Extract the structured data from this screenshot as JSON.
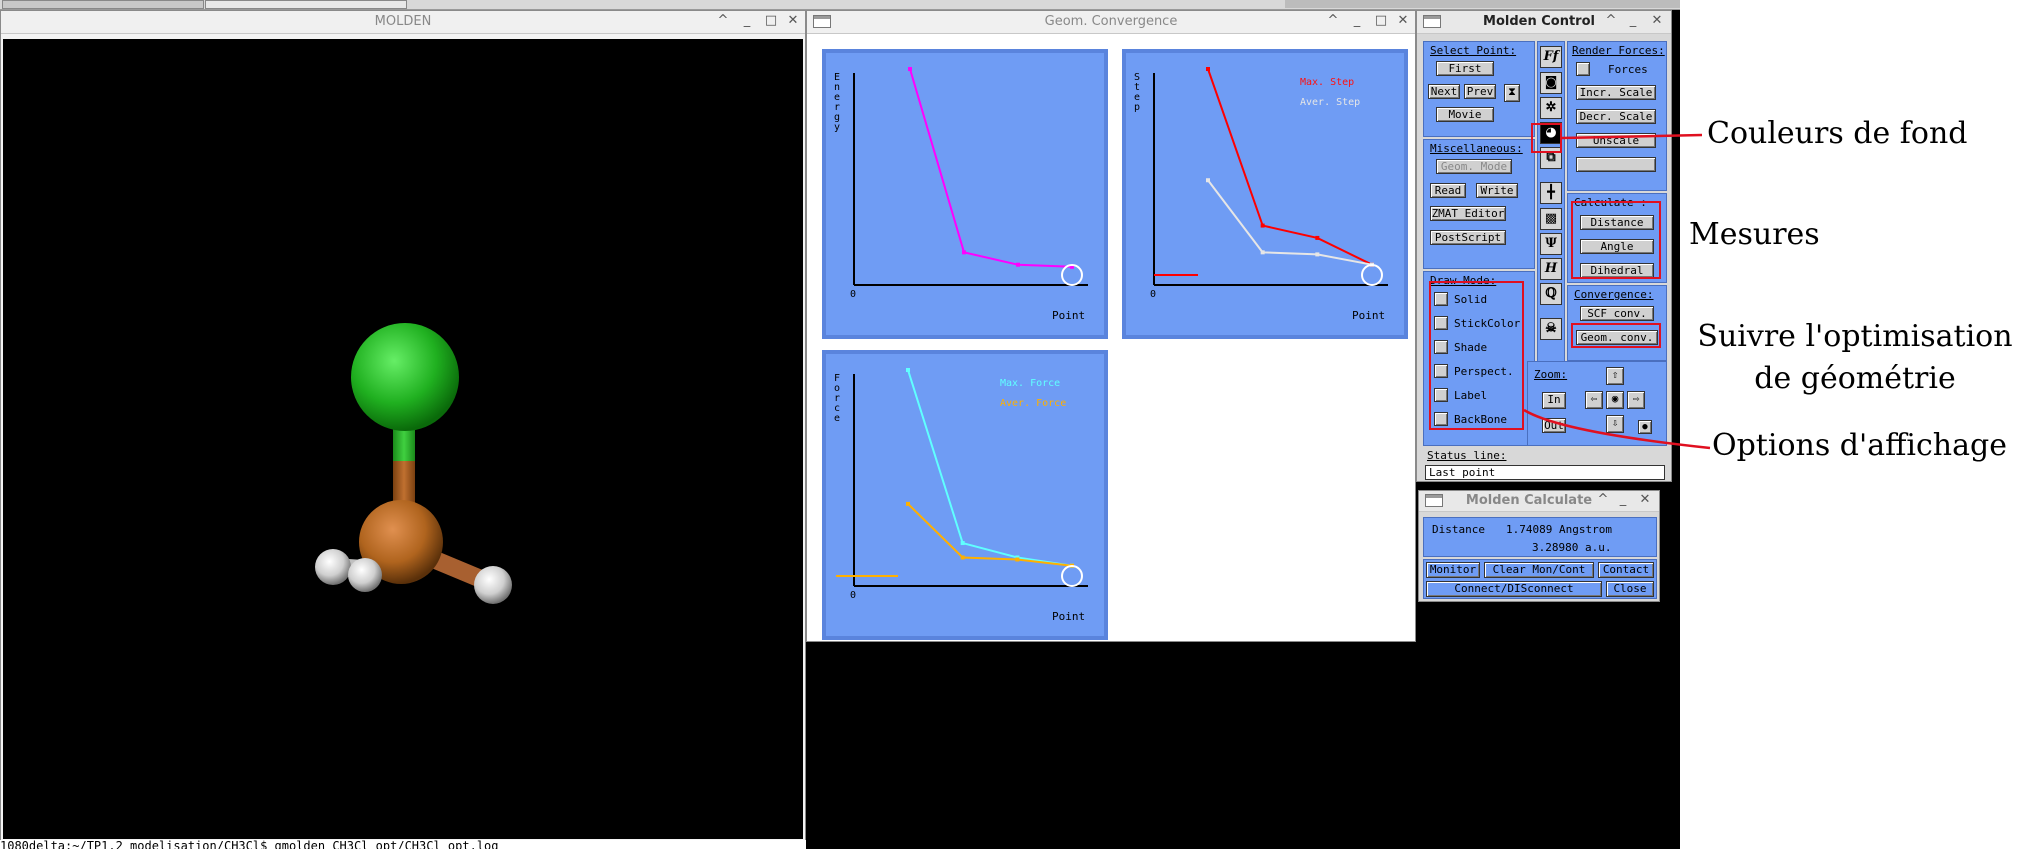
{
  "molden_window": {
    "title": "MOLDEN"
  },
  "terminal_line": "1080delta:~/TP1.2_modelisation/CH3Cl$ gmolden CH3Cl_opt/CH3Cl_opt.log",
  "conv_window": {
    "title": "Geom. Convergence"
  },
  "charts": {
    "energy": {
      "ylabel": "Energy",
      "xlabel": "Point",
      "origin": "0"
    },
    "step": {
      "ylabel": "Step",
      "xlabel": "Point",
      "origin": "0",
      "legend_max": "Max. Step",
      "legend_aver": "Aver. Step"
    },
    "force": {
      "ylabel": "Force",
      "xlabel": "Point",
      "origin": "0",
      "legend_max": "Max. Force",
      "legend_aver": "Aver. Force"
    }
  },
  "chart_data": [
    {
      "type": "line",
      "title": "",
      "xlabel": "Point",
      "ylabel": "Energy",
      "x": [
        1,
        2,
        3,
        4
      ],
      "series": [
        {
          "values": [
            100,
            11,
            5,
            4
          ],
          "color": "#ff00ff"
        }
      ]
    },
    {
      "type": "line",
      "title": "",
      "xlabel": "Point",
      "ylabel": "Step",
      "x": [
        1,
        2,
        3,
        4
      ],
      "series": [
        {
          "name": "Max. Step",
          "values": [
            100,
            24,
            18,
            5
          ],
          "color": "#ff0000"
        },
        {
          "name": "Aver. Step",
          "values": [
            46,
            11,
            10,
            5
          ],
          "color": "#e6e6e6"
        }
      ]
    },
    {
      "type": "line",
      "title": "",
      "xlabel": "Point",
      "ylabel": "Force",
      "x": [
        1,
        2,
        3,
        4
      ],
      "series": [
        {
          "name": "Max. Force",
          "values": [
            100,
            16,
            9,
            5
          ],
          "color": "#60ffff"
        },
        {
          "name": "Aver. Force",
          "values": [
            35,
            9,
            8,
            5
          ],
          "color": "#ffb000"
        }
      ]
    }
  ],
  "control": {
    "title": "Molden Control",
    "select_point": "Select Point:",
    "first": "First",
    "next": "Next",
    "prev": "Prev",
    "movie": "Movie",
    "miscellaneous": "Miscellaneous:",
    "geom_mode": "Geom. Mode",
    "read": "Read",
    "write": "Write",
    "zmat_editor": "ZMAT Editor",
    "postscript": "PostScript",
    "draw_mode": "Draw Mode:",
    "draw_options": [
      "Solid",
      "StickColor",
      "Shade",
      "Perspect.",
      "Label",
      "BackBone"
    ],
    "render_forces": "Render Forces:",
    "forces": "Forces",
    "incr_scale": "Incr. Scale",
    "decr_scale": "Decr. Scale",
    "unscale": "Unscale",
    "calculate": "Calculate :",
    "distance": "Distance",
    "angle": "Angle",
    "dihedral": "Dihedral",
    "convergence": "Convergence:",
    "scf_conv": "SCF conv.",
    "geom_conv": "Geom. conv.",
    "zoom": "Zoom:",
    "zoom_in": "In",
    "zoom_out": "Out",
    "status_line": "Status line:",
    "status_value": "Last point",
    "icons": [
      "Ff",
      "H",
      "H"
    ]
  },
  "calc": {
    "title": "Molden Calculate",
    "distance_label": "Distance",
    "distance_angstrom": "1.74089 Angstrom",
    "distance_au": "3.28980 a.u.",
    "monitor": "Monitor",
    "clear": "Clear Mon/Cont",
    "contact": "Contact",
    "connect": "Connect/DISconnect",
    "close": "Close"
  },
  "annotations": {
    "background": "Couleurs de fond",
    "measures": "Mesures",
    "follow_line1": "Suivre l'optimisation",
    "follow_line2": "de géométrie",
    "display": "Options d'affichage"
  },
  "colors": {
    "annotation_red": "#e01020",
    "panel_blue": "#6f9cf4",
    "chlorine": "#22c022",
    "carbon": "#b0641e",
    "hydrogen": "#d8d8d8"
  }
}
